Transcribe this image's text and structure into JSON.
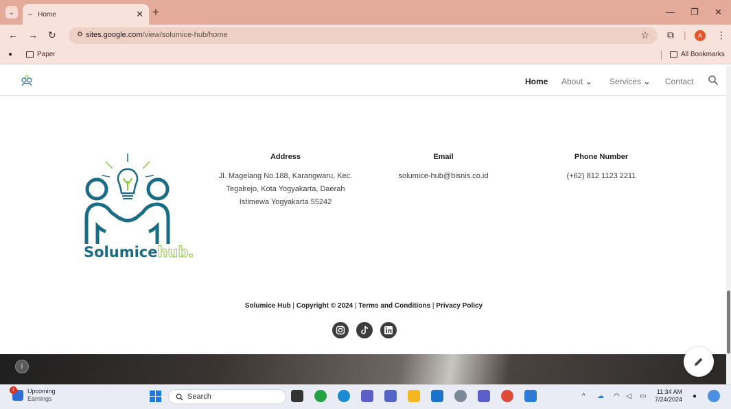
{
  "browser": {
    "tab_title": "Home",
    "url_domain": "sites.google.com",
    "url_path": "/view/solumice-hub/home",
    "bookmarks": [
      "Paper"
    ],
    "all_bookmarks": "All Bookmarks",
    "profile_initial": "A"
  },
  "site": {
    "nav": {
      "home": "Home",
      "about": "About",
      "services": "Services",
      "contact": "Contact"
    },
    "logo_text": "Solumice",
    "logo_text_accent": "hub.",
    "address": {
      "title": "Address",
      "lines": [
        "Jl. Magelang No.188, Karangwaru, Kec.",
        "Tegalrejo, Kota Yogyakarta, Daerah",
        "Istimewa Yogyakarta 55242"
      ]
    },
    "email": {
      "title": "Email",
      "value": "solumice-hub@bisnis.co.id"
    },
    "phone": {
      "title": "Phone Number",
      "value": "(+62) 812 1123 2211"
    },
    "copyright": {
      "brand": "Solumice Hub",
      "text": "Copyright © 2024",
      "terms": "Terms and Conditions",
      "privacy": "Privacy Policy",
      "separator": "|"
    },
    "social": [
      "instagram-icon",
      "tiktok-icon",
      "linkedin-icon"
    ]
  },
  "taskbar": {
    "weather_title": "Upcoming",
    "weather_sub": "Earnings",
    "notif_count": "1",
    "search_placeholder": "Search",
    "time": "11:34 AM",
    "date": "7/24/2024"
  },
  "colors": {
    "chrome_tab_bar": "#e5ab9a",
    "chrome_toolbar": "#f8e3dc",
    "logo_teal": "#1a6b86",
    "logo_green": "#8cc63f",
    "taskbar": "#e9ecf5"
  }
}
